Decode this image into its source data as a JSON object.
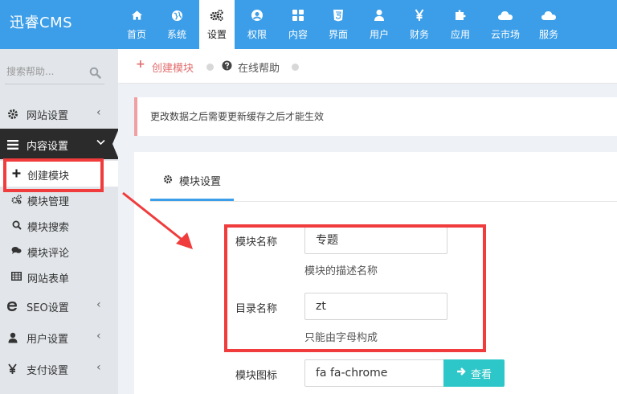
{
  "app": {
    "logo": "迅睿CMS"
  },
  "topnav": {
    "items": [
      {
        "label": "首页",
        "icon": "home-icon"
      },
      {
        "label": "系统",
        "icon": "globe-icon"
      },
      {
        "label": "设置",
        "icon": "cogs-icon",
        "active": true
      },
      {
        "label": "权限",
        "icon": "user-circle-icon"
      },
      {
        "label": "内容",
        "icon": "grid-icon"
      },
      {
        "label": "界面",
        "icon": "html5-icon"
      },
      {
        "label": "用户",
        "icon": "user-icon"
      },
      {
        "label": "财务",
        "icon": "yen-icon"
      },
      {
        "label": "应用",
        "icon": "puzzle-icon"
      },
      {
        "label": "云市场",
        "icon": "cloud-icon"
      },
      {
        "label": "服务",
        "icon": "cloud-icon"
      }
    ]
  },
  "sidebar": {
    "search_placeholder": "搜索帮助...",
    "site_settings": "网站设置",
    "content_settings": "内容设置",
    "sub_items": [
      {
        "label": "创建模块",
        "icon": "plus-icon"
      },
      {
        "label": "模块管理",
        "icon": "cogs-icon"
      },
      {
        "label": "模块搜索",
        "icon": "search-icon"
      },
      {
        "label": "模块评论",
        "icon": "comments-icon"
      },
      {
        "label": "网站表单",
        "icon": "table-icon"
      }
    ],
    "seo_settings": "SEO设置",
    "user_settings": "用户设置",
    "pay_settings": "支付设置"
  },
  "breadcrumb": {
    "create_module": "创建模块",
    "online_help": "在线帮助"
  },
  "notice": {
    "text": "更改数据之后需要更新缓存之后才能生效"
  },
  "tab": {
    "label": "模块设置"
  },
  "form": {
    "module_name_label": "模块名称",
    "module_name_value": "专题",
    "module_name_help": "模块的描述名称",
    "dir_name_label": "目录名称",
    "dir_name_value": "zt",
    "dir_name_help": "只能由字母构成",
    "icon_label": "模块图标",
    "icon_value": "fa fa-chrome",
    "view_button": "查看"
  },
  "colors": {
    "topbar": "#3c9ee8",
    "annotation": "#f03c3c",
    "accent_button": "#2ec7c9",
    "breadcrumb_active": "#e26d6d"
  }
}
